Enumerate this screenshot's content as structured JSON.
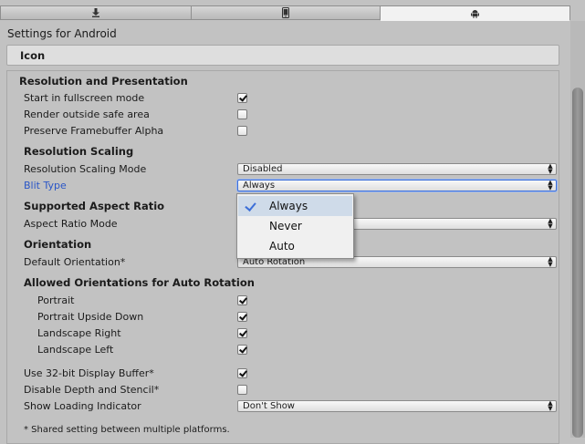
{
  "platform_tabs": [
    {
      "icon": "download-icon",
      "active": false
    },
    {
      "icon": "phone-icon",
      "active": false
    },
    {
      "icon": "android-icon",
      "active": true
    }
  ],
  "settings_title": "Settings for Android",
  "icon_section": {
    "label": "Icon"
  },
  "resolution": {
    "header": "Resolution and Presentation",
    "start_fullscreen": {
      "label": "Start in fullscreen mode",
      "checked": true
    },
    "render_outside_safe": {
      "label": "Render outside safe area",
      "checked": false
    },
    "preserve_alpha": {
      "label": "Preserve Framebuffer Alpha",
      "checked": false
    },
    "scaling_header": "Resolution Scaling",
    "scaling_mode": {
      "label": "Resolution Scaling Mode",
      "value": "Disabled"
    },
    "blit_type": {
      "label": "Blit Type",
      "value": "Always",
      "options": [
        "Always",
        "Never",
        "Auto"
      ]
    },
    "aspect_header": "Supported Aspect Ratio",
    "aspect_mode": {
      "label": "Aspect Ratio Mode"
    },
    "orientation_header": "Orientation",
    "default_orientation": {
      "label": "Default Orientation*",
      "value": "Auto Rotation"
    },
    "allowed_header": "Allowed Orientations for Auto Rotation",
    "portrait": {
      "label": "Portrait",
      "checked": true
    },
    "portrait_upside_down": {
      "label": "Portrait Upside Down",
      "checked": true
    },
    "landscape_right": {
      "label": "Landscape Right",
      "checked": true
    },
    "landscape_left": {
      "label": "Landscape Left",
      "checked": true
    },
    "display_buffer": {
      "label": "Use 32-bit Display Buffer*",
      "checked": true
    },
    "disable_depth": {
      "label": "Disable Depth and Stencil*",
      "checked": false
    },
    "loading_indicator": {
      "label": "Show Loading Indicator",
      "value": "Don't Show"
    },
    "footer_note": "* Shared setting between multiple platforms."
  },
  "colors": {
    "accent": "#3d6fd8",
    "label_focus": "#2a56c7",
    "background": "#c2c2c2"
  }
}
